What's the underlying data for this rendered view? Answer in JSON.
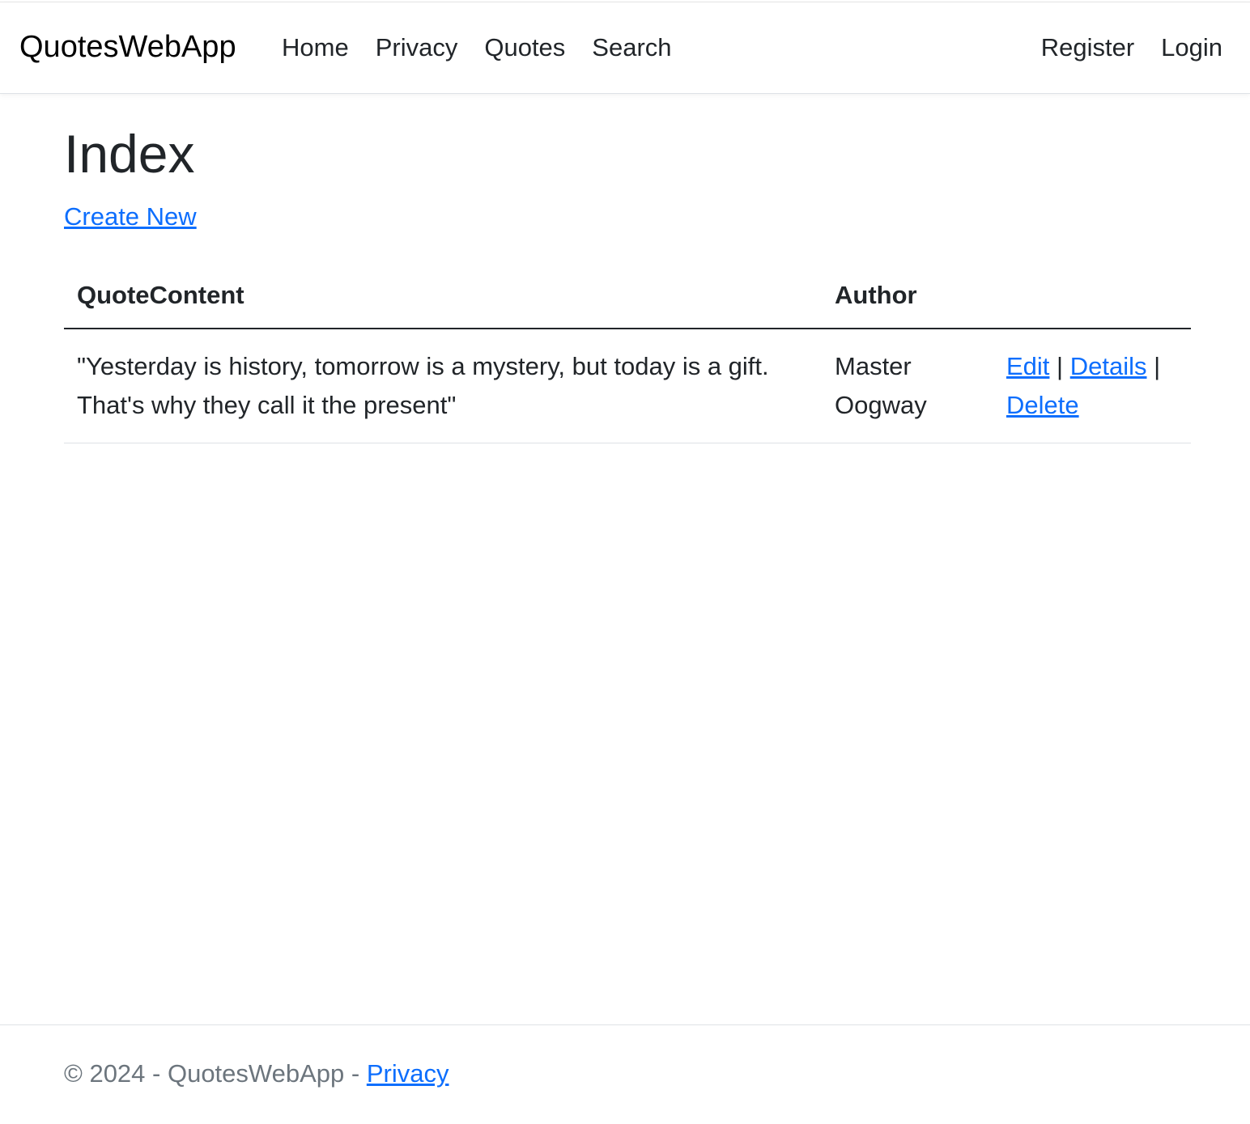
{
  "nav": {
    "brand": "QuotesWebApp",
    "links": [
      "Home",
      "Privacy",
      "Quotes",
      "Search"
    ],
    "right": [
      "Register",
      "Login"
    ]
  },
  "main": {
    "title": "Index",
    "create_new": "Create New",
    "table": {
      "headers": [
        "QuoteContent",
        "Author",
        ""
      ],
      "rows": [
        {
          "quote": "\"Yesterday is history, tomorrow is a mystery, but today is a gift. That's why they call it the present\"",
          "author": "Master Oogway",
          "edit": "Edit",
          "details": "Details",
          "delete": "Delete",
          "sep": "|"
        }
      ]
    }
  },
  "footer": {
    "text": "© 2024 - QuotesWebApp - ",
    "privacy": "Privacy"
  },
  "colors": {
    "link": "#0d6efd",
    "text": "#212529",
    "muted": "#6c757d"
  }
}
